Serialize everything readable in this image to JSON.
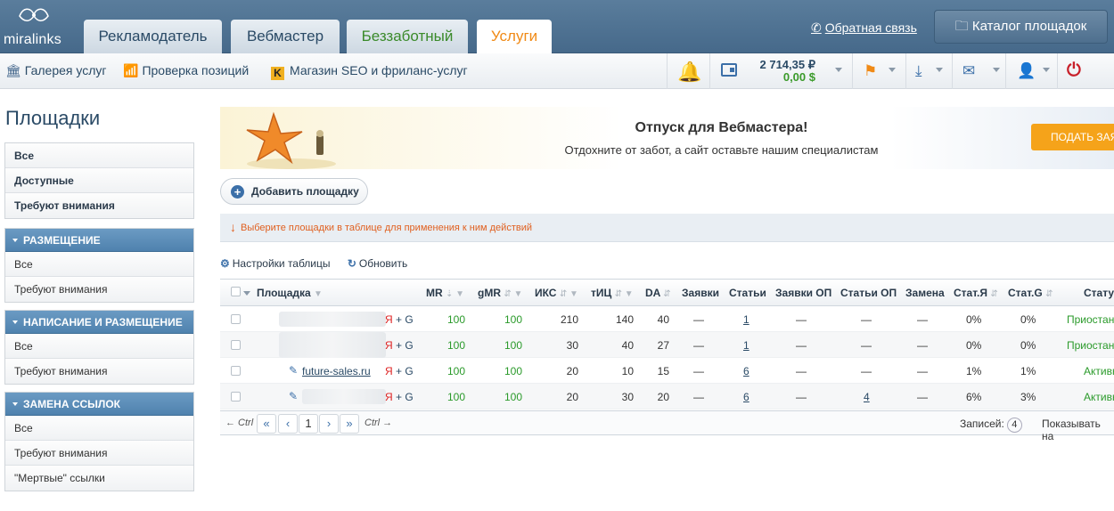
{
  "header": {
    "logo_text": "miralinks",
    "tabs": [
      {
        "label": "Рекламодатель"
      },
      {
        "label": "Вебмастер"
      },
      {
        "label": "Беззаботный"
      },
      {
        "label": "Услуги"
      }
    ],
    "feedback": "Обратная связь",
    "catalog_button": "Каталог площадок"
  },
  "subbar": {
    "links": [
      "Галерея услуг",
      "Проверка позиций",
      "Магазин SEO и фриланс-услуг"
    ],
    "balance_rub": "2 714,35 ₽",
    "balance_usd": "0,00 $"
  },
  "sidebar": {
    "title": "Площадки",
    "main_items": [
      "Все",
      "Доступные",
      "Требуют внимания"
    ],
    "sections": [
      {
        "title": "РАЗМЕЩЕНИЕ",
        "items": [
          "Все",
          "Требуют внимания"
        ]
      },
      {
        "title": "НАПИСАНИЕ И РАЗМЕЩЕНИЕ",
        "items": [
          "Все",
          "Требуют внимания"
        ]
      },
      {
        "title": "ЗАМЕНА ССЫЛОК",
        "items": [
          "Все",
          "Требуют внимания",
          "\"Мертвые\" ссылки"
        ]
      }
    ]
  },
  "banner": {
    "title": "Отпуск для Вебмастера!",
    "subtitle": "Отдохните от забот, а сайт оставьте нашим специалистам",
    "button": "ПОДАТЬ ЗАЯ"
  },
  "add_button": "Добавить площадку",
  "notice": "Выберите площадки в таблице для применения к ним действий",
  "table_controls": {
    "settings": "Настройки таблицы",
    "refresh": "Обновить"
  },
  "table": {
    "headers": [
      "Площадка",
      "MR",
      "gMR",
      "ИКС",
      "тИЦ",
      "DA",
      "Заявки",
      "Статьи",
      "Заявки ОП",
      "Статьи ОП",
      "Замена",
      "Стат.Я",
      "Стат.G",
      "Статус"
    ],
    "rows": [
      {
        "site": "",
        "engines": [
          "Я",
          "+ G"
        ],
        "mr": "100",
        "gmr": "100",
        "iks": "210",
        "tic": "140",
        "da": "40",
        "requests": "—",
        "articles": "1",
        "req_op": "—",
        "art_op": "—",
        "replace": "—",
        "stat_y": "0%",
        "stat_g": "0%",
        "status": "Приостано"
      },
      {
        "site": "",
        "engines": [
          "Я",
          "+ G"
        ],
        "mr": "100",
        "gmr": "100",
        "iks": "30",
        "tic": "40",
        "da": "27",
        "requests": "—",
        "articles": "1",
        "req_op": "—",
        "art_op": "—",
        "replace": "—",
        "stat_y": "0%",
        "stat_g": "0%",
        "status": "Приостано"
      },
      {
        "site": "future-sales.ru",
        "engines": [
          "Я",
          "+ G"
        ],
        "mr": "100",
        "gmr": "100",
        "iks": "20",
        "tic": "10",
        "da": "15",
        "requests": "—",
        "articles": "6",
        "req_op": "—",
        "art_op": "—",
        "replace": "—",
        "stat_y": "1%",
        "stat_g": "1%",
        "status": "Активн"
      },
      {
        "site": "",
        "engines": [
          "Я",
          "+ G"
        ],
        "mr": "100",
        "gmr": "100",
        "iks": "20",
        "tic": "30",
        "da": "20",
        "requests": "—",
        "articles": "6",
        "req_op": "—",
        "art_op": "4",
        "replace": "—",
        "stat_y": "6%",
        "stat_g": "3%",
        "status": "Активн"
      }
    ]
  },
  "pager": {
    "prev_hint": "← Ctrl",
    "first": "«",
    "prev": "‹",
    "page": "1",
    "next": "›",
    "last": "»",
    "next_hint": "Ctrl →",
    "records_label": "Записей:",
    "records_count": "4",
    "show_label": "Показывать на"
  }
}
